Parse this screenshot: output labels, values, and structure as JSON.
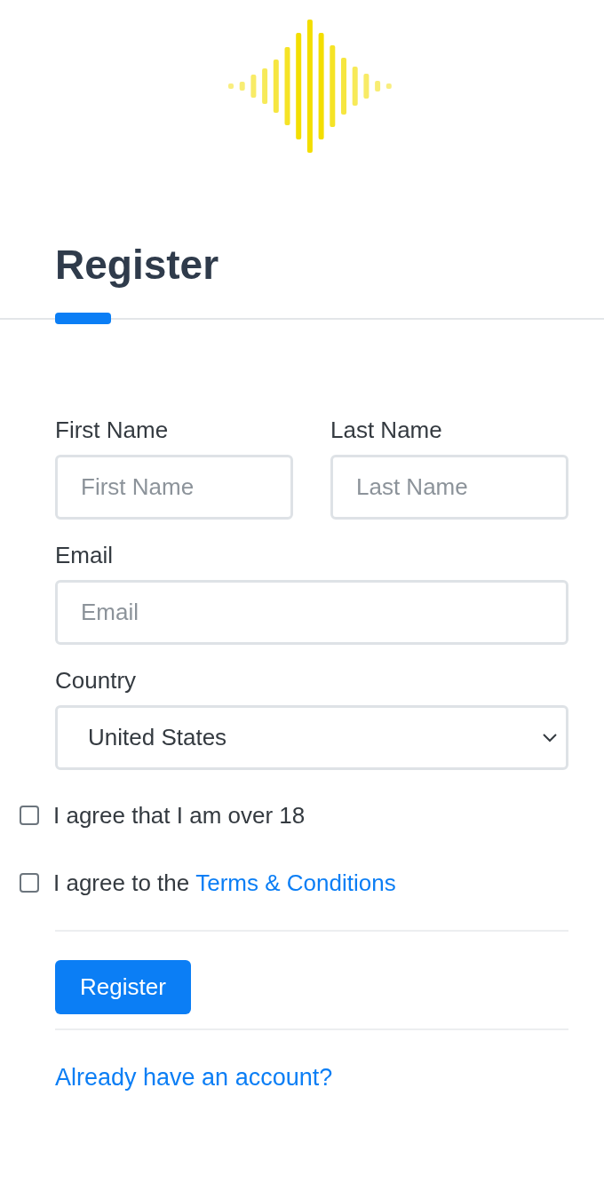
{
  "title": "Register",
  "name_fields": [
    {
      "label": "First Name",
      "placeholder": "First Name"
    },
    {
      "label": "Last Name",
      "placeholder": "Last Name"
    }
  ],
  "email": {
    "label": "Email",
    "placeholder": "Email"
  },
  "country": {
    "label": "Country",
    "value": "United States"
  },
  "checkboxes": [
    {
      "text": "I agree that I am over 18",
      "checked": false
    },
    {
      "text": "I agree to the",
      "link": "Terms & Conditions",
      "checked": false
    }
  ],
  "submit_button": "Register",
  "login_link": "Already have an account?"
}
